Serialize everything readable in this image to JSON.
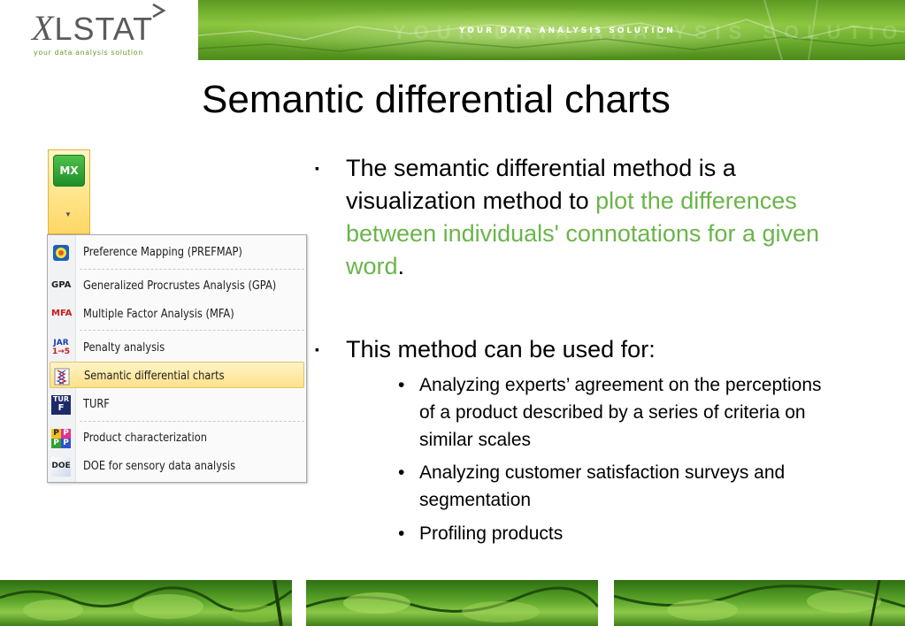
{
  "header": {
    "logo_mark": "X",
    "logo_text": "LSTAT",
    "logo_tagline": "your data analysis solution",
    "banner_ghost": "YOUR DATA ANALYSIS SOLUTION",
    "banner_text": "YOUR DATA ANALYSIS SOLUTION"
  },
  "title": "Semantic differential charts",
  "ribbon": {
    "button_label": "MX",
    "dropdown_icon": "chevron-down-icon"
  },
  "menu": {
    "items": [
      {
        "label": "Preference Mapping (PREFMAP)",
        "icon": "prefmap-icon"
      },
      {
        "label": "Generalized Procrustes Analysis (GPA)",
        "icon": "GPA"
      },
      {
        "label": "Multiple Factor Analysis (MFA)",
        "icon": "MFA"
      },
      {
        "label": "Penalty analysis",
        "icon_top": "JAR",
        "icon_bottom": "1→5"
      },
      {
        "label": "Semantic differential charts",
        "icon": "semantic-chart-icon",
        "selected": true
      },
      {
        "label": "TURF",
        "icon_top": "TUR",
        "icon_bottom": "F"
      },
      {
        "label": "Product characterization",
        "icon_letters": [
          "P",
          "P",
          "P",
          "P"
        ]
      },
      {
        "label": "DOE for sensory data analysis",
        "icon": "DOE"
      }
    ]
  },
  "bullets": {
    "b1_before": "The semantic differential method is a visualization method to ",
    "b1_highlight": "plot the differences between individuals' connotations for a given word",
    "b1_after": ".",
    "b2": "This method can be used for:",
    "sub": [
      "Analyzing experts’ agreement on the perceptions of a product described by a series of criteria on similar scales",
      "Analyzing customer satisfaction surveys and segmentation",
      "Profiling products"
    ],
    "mark_main": "▪",
    "mark_sub": "•"
  },
  "colors": {
    "highlight": "#6ab54a",
    "banner_green": "#8cc63f",
    "menu_selected": "#ffe18a"
  }
}
